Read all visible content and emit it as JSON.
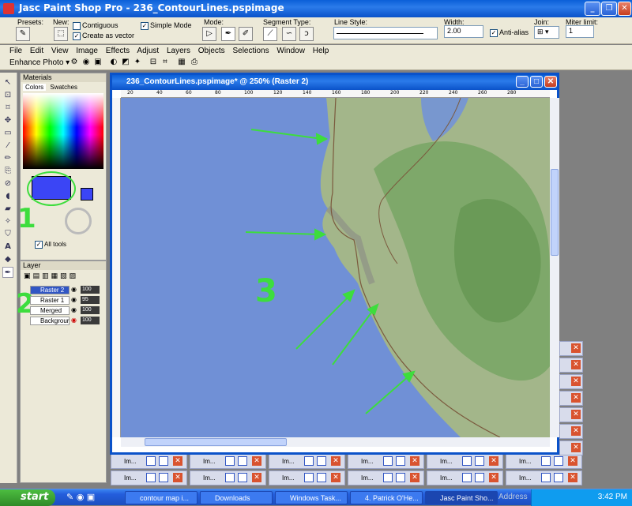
{
  "app": {
    "title": "Jasc Paint Shop Pro - 236_ContourLines.pspimage"
  },
  "tool_options": {
    "presets_label": "Presets:",
    "new_label": "New:",
    "contiguous_label": "Contiguous",
    "create_vector_label": "Create as vector",
    "simple_mode_label": "Simple Mode",
    "mode_label": "Mode:",
    "segment_type_label": "Segment Type:",
    "line_style_label": "Line Style:",
    "width_label": "Width:",
    "width_value": "2.00",
    "antialias_label": "Anti-alias",
    "join_label": "Join:",
    "miter_label": "Miter limit:",
    "miter_value": "1"
  },
  "menu": [
    "File",
    "Edit",
    "View",
    "Image",
    "Effects",
    "Adjust",
    "Layers",
    "Objects",
    "Selections",
    "Window",
    "Help"
  ],
  "enhance_photo": "Enhance Photo ▾",
  "materials": {
    "title": "Materials",
    "tab_colors": "Colors",
    "tab_swatches": "Swatches",
    "all_tools": "All tools",
    "fg_color": "#3b45f5",
    "bg_color": "#3b45f5"
  },
  "layers": {
    "title": "Layer",
    "rows": [
      {
        "name": "Raster 2",
        "opacity": "100"
      },
      {
        "name": "Raster 1",
        "opacity": "95"
      },
      {
        "name": "Merged",
        "opacity": "100"
      },
      {
        "name": "Backgrour",
        "opacity": "100"
      }
    ]
  },
  "document": {
    "title": "236_ContourLines.pspimage* @ 250% (Raster 2)",
    "ruler_ticks": [
      "20",
      "40",
      "60",
      "80",
      "100",
      "120",
      "140",
      "160",
      "180",
      "200",
      "220",
      "240",
      "260",
      "280"
    ]
  },
  "annotations": {
    "one": "1",
    "two": "2",
    "three": "3"
  },
  "minimized_label": "Im...",
  "taskbar": {
    "start": "start",
    "items": [
      "contour map i...",
      "Downloads",
      "Windows Task...",
      "4. Patrick O'He...",
      "Jasc Paint Sho..."
    ],
    "address": "Address",
    "clock": "3:42 PM"
  }
}
